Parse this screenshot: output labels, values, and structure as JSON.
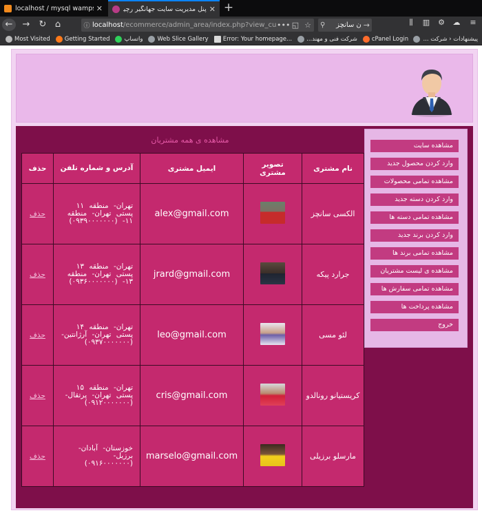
{
  "browser": {
    "tabs": [
      {
        "title": "localhost / mysql wampserver / ec"
      },
      {
        "title": "پنل مدیریت سایت جهانگیر رچیکم"
      }
    ],
    "new_tab_symbol": "+",
    "url_host": "localhost",
    "url_path": "/ecommerce/admin_area/index.php?view_custo",
    "url_more": "•••",
    "search_query": "ن سانچز",
    "bookmarks_left": [
      {
        "label": "Most Visited",
        "icon": "gear-icon"
      },
      {
        "label": "Getting Started",
        "icon": "firefox-icon"
      },
      {
        "label": "واتساپ",
        "icon": "whatsapp-icon"
      },
      {
        "label": "Web Slice Gallery",
        "icon": "globe-icon"
      },
      {
        "label": "Error: Your homepage...",
        "icon": "page-icon"
      },
      {
        "label": "شرکت فنی و مهند...",
        "icon": "globe-icon"
      },
      {
        "label": "cPanel Login",
        "icon": "cpanel-icon"
      }
    ],
    "bookmarks_right": "پیشنهادات ‹ شرکت ..."
  },
  "sidebar": {
    "items": [
      {
        "label": "مشاهده سایت"
      },
      {
        "label": "وارد کردن محصول جدید"
      },
      {
        "label": "مشاهده تمامی محصولات"
      },
      {
        "label": "وارد کردن دسته جدید"
      },
      {
        "label": "مشاهده تمامی دسته ها"
      },
      {
        "label": "وارد کردن برند جدید"
      },
      {
        "label": "مشاهده تمامی برند ها"
      },
      {
        "label": "مشاهده ی لیست مشتریان"
      },
      {
        "label": "مشاهده تمامی سفارش ها"
      },
      {
        "label": "مشاهده پرداخت ها"
      },
      {
        "label": "خروج"
      }
    ]
  },
  "content": {
    "title": "مشاهده ی همه مشتریان",
    "headers": {
      "name": "نام مشتری",
      "image": "تصویر مشتری",
      "email": "ایمیل مشتری",
      "address": "آدرس و شماره تلفن",
      "delete": "حذف"
    },
    "rows": [
      {
        "name": "الکسی سانچز",
        "email": "alex@gmail.com",
        "address": "تهران- منطقه ۱۱ پستی تهران- منطقه ۱۱- (۰۹۳۹۰۰۰۰۰۰۰)",
        "delete": "حذف",
        "thumb": "red-jersey"
      },
      {
        "name": "جرارد پیکه",
        "email": "jrard@gmail.com",
        "address": "تهران- منطقه ۱۳ پستی تهران- منطقه ۱۳- (۰۹۳۶۰۰۰۰۰۰۰)",
        "delete": "حذف",
        "thumb": "dark-jersey"
      },
      {
        "name": "لئو مسی",
        "email": "leo@gmail.com",
        "address": "تهران- منطقه ۱۴ پستی تهران- آرژانتین- (۰۹۳۷۰۰۰۰۰۰۰)",
        "delete": "حذف",
        "thumb": "white-bg"
      },
      {
        "name": "کریستیانو رونالدو",
        "email": "cris@gmail.com",
        "address": "تهران- منطقه ۱۵ پستی تهران- پرتقال- (۰۹۱۲۰۰۰۰۰۰۰)",
        "delete": "حذف",
        "thumb": "red-white"
      },
      {
        "name": "مارسلو برزیلی",
        "email": "marselo@gmail.com",
        "address": "خوزستان- آبادان- برزیل- (۰۹۱۶۰۰۰۰۰۰۰)",
        "delete": "حذف",
        "thumb": "yellow-jersey"
      }
    ]
  },
  "colors": {
    "main_bg": "#7e0f4a",
    "table_bg": "#c4296e",
    "menu_item": "#c23b81",
    "header_bg": "#eab8ea",
    "page_bg": "#f2d4f2"
  }
}
